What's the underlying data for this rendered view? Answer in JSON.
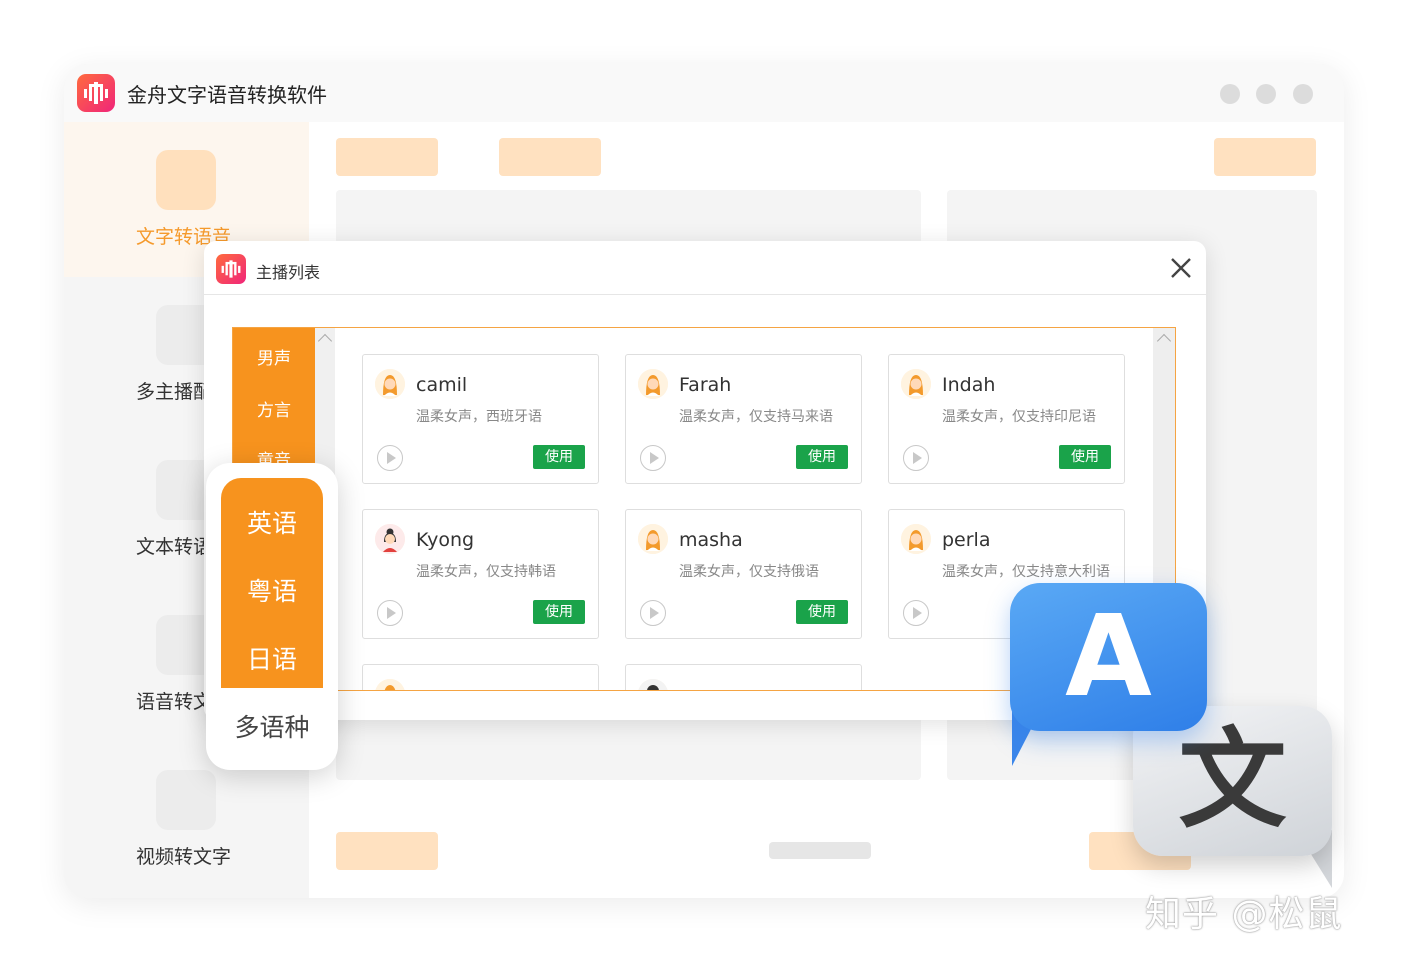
{
  "app": {
    "title": "金舟文字语音转换软件",
    "accent": "#f7931e"
  },
  "sidebar": {
    "items": [
      {
        "label": "文字转语音",
        "active": true
      },
      {
        "label": "多主播配"
      },
      {
        "label": "文本转语"
      },
      {
        "label": "语音转文"
      },
      {
        "label": "视频转文字"
      }
    ]
  },
  "modal": {
    "title": "主播列表",
    "categories": [
      "男声",
      "方言",
      "童音"
    ],
    "use_label": "使用",
    "cards": [
      {
        "name": "camil",
        "desc": "温柔女声，西班牙语",
        "avatar": "female-avatar"
      },
      {
        "name": "Farah",
        "desc": "温柔女声，仅支持马来语",
        "avatar": "female-avatar"
      },
      {
        "name": "Indah",
        "desc": "温柔女声，仅支持印尼语",
        "avatar": "female-avatar"
      },
      {
        "name": "Kyong",
        "desc": "温柔女声，仅支持韩语",
        "avatar": "female-avatar"
      },
      {
        "name": "masha",
        "desc": "温柔女声，仅支持俄语",
        "avatar": "female-avatar"
      },
      {
        "name": "perla",
        "desc": "温柔女声，仅支持意大利语",
        "avatar": "female-avatar"
      }
    ]
  },
  "lang_popup": {
    "items": [
      "英语",
      "粤语",
      "日语"
    ],
    "multi_label": "多语种"
  },
  "illustration": {
    "letter_a": "A",
    "letter_wen": "文"
  },
  "watermark": "知乎 @松鼠"
}
